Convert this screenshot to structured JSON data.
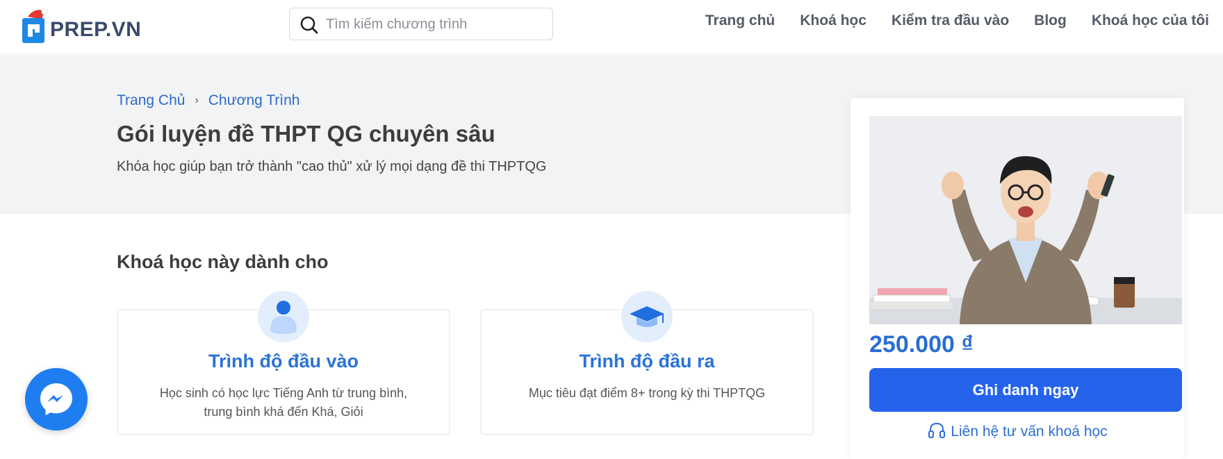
{
  "header": {
    "logo_text": "PREP.VN",
    "search_placeholder": "Tìm kiếm chương trình",
    "nav": [
      "Trang chủ",
      "Khoá học",
      "Kiểm tra đầu vào",
      "Blog",
      "Khoá học của tôi"
    ]
  },
  "hero": {
    "breadcrumb": [
      "Trang Chủ",
      "Chương Trình"
    ],
    "title": "Gói luyện đề THPT QG chuyên sâu",
    "subtitle": "Khóa học giúp bạn trở thành \"cao thủ\" xử lý mọi dạng đề thi THPTQG"
  },
  "section": {
    "title": "Khoá học này dành cho",
    "cards": [
      {
        "icon": "user-icon",
        "title": "Trình độ đầu vào",
        "desc": "Học sinh có học lực Tiếng Anh từ trung bình, trung bình khá đến Khá, Giỏi"
      },
      {
        "icon": "graduation-cap-icon",
        "title": "Trình độ đầu ra",
        "desc": "Mục tiêu đạt điểm 8+ trong kỳ thi THPTQG"
      }
    ]
  },
  "panel": {
    "price": "250.000 ₫",
    "enroll_label": "Ghi danh ngay",
    "contact_label": "Liên hệ tư vấn khoá học"
  },
  "colors": {
    "accent": "#2563eb",
    "link": "#2b6bc7",
    "hero_bg": "#f2f3f5"
  }
}
